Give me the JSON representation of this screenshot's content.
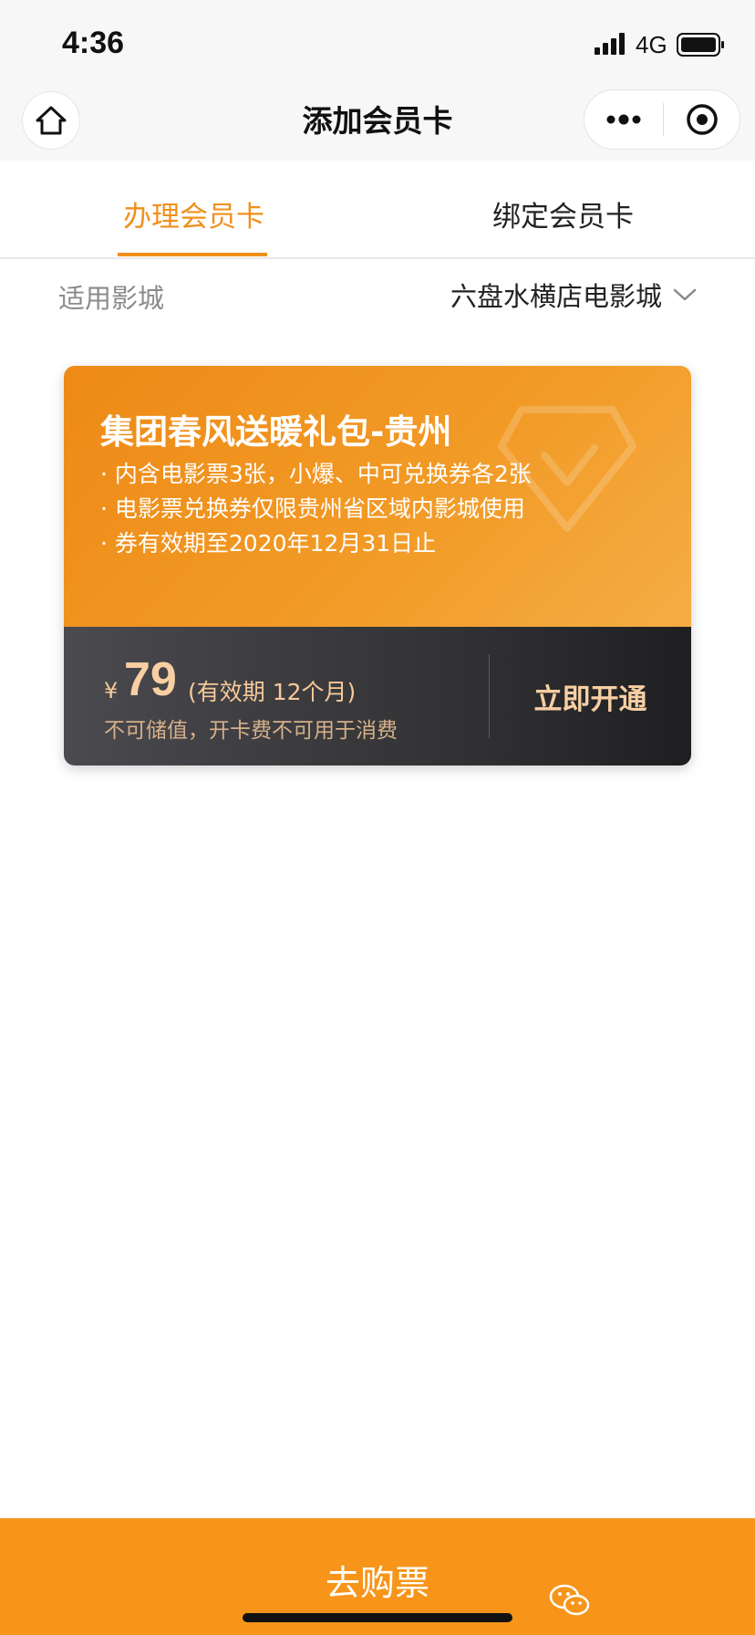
{
  "status_bar": {
    "time": "4:36",
    "network": "4G",
    "signal_icon": "signal-icon",
    "battery_icon": "battery-icon"
  },
  "nav": {
    "title": "添加会员卡",
    "home_icon": "home-icon",
    "more_icon": "more-dots-icon",
    "close_icon": "target-close-icon"
  },
  "tabs": [
    {
      "label": "办理会员卡",
      "active": true
    },
    {
      "label": "绑定会员卡",
      "active": false
    }
  ],
  "cinema": {
    "label": "适用影城",
    "selected": "六盘水横店电影城"
  },
  "card": {
    "title": "集团春风送暖礼包-贵州",
    "features": [
      "内含电影票3张，小爆、中可兑换券各2张",
      "电影票兑换券仅限贵州省区域内影城使用",
      "券有效期至2020年12月31日止"
    ],
    "currency": "¥",
    "price": "79",
    "validity": "(有效期 12个月)",
    "note": "不可储值，开卡费不可用于消费",
    "action_label": "立即开通"
  },
  "bottom_bar": {
    "label": "去购票"
  },
  "colors": {
    "accent": "#f0901b",
    "card_gold_text": "#f8cfa3",
    "card_dark": "#333335",
    "bottom_bar": "#f7951a"
  }
}
